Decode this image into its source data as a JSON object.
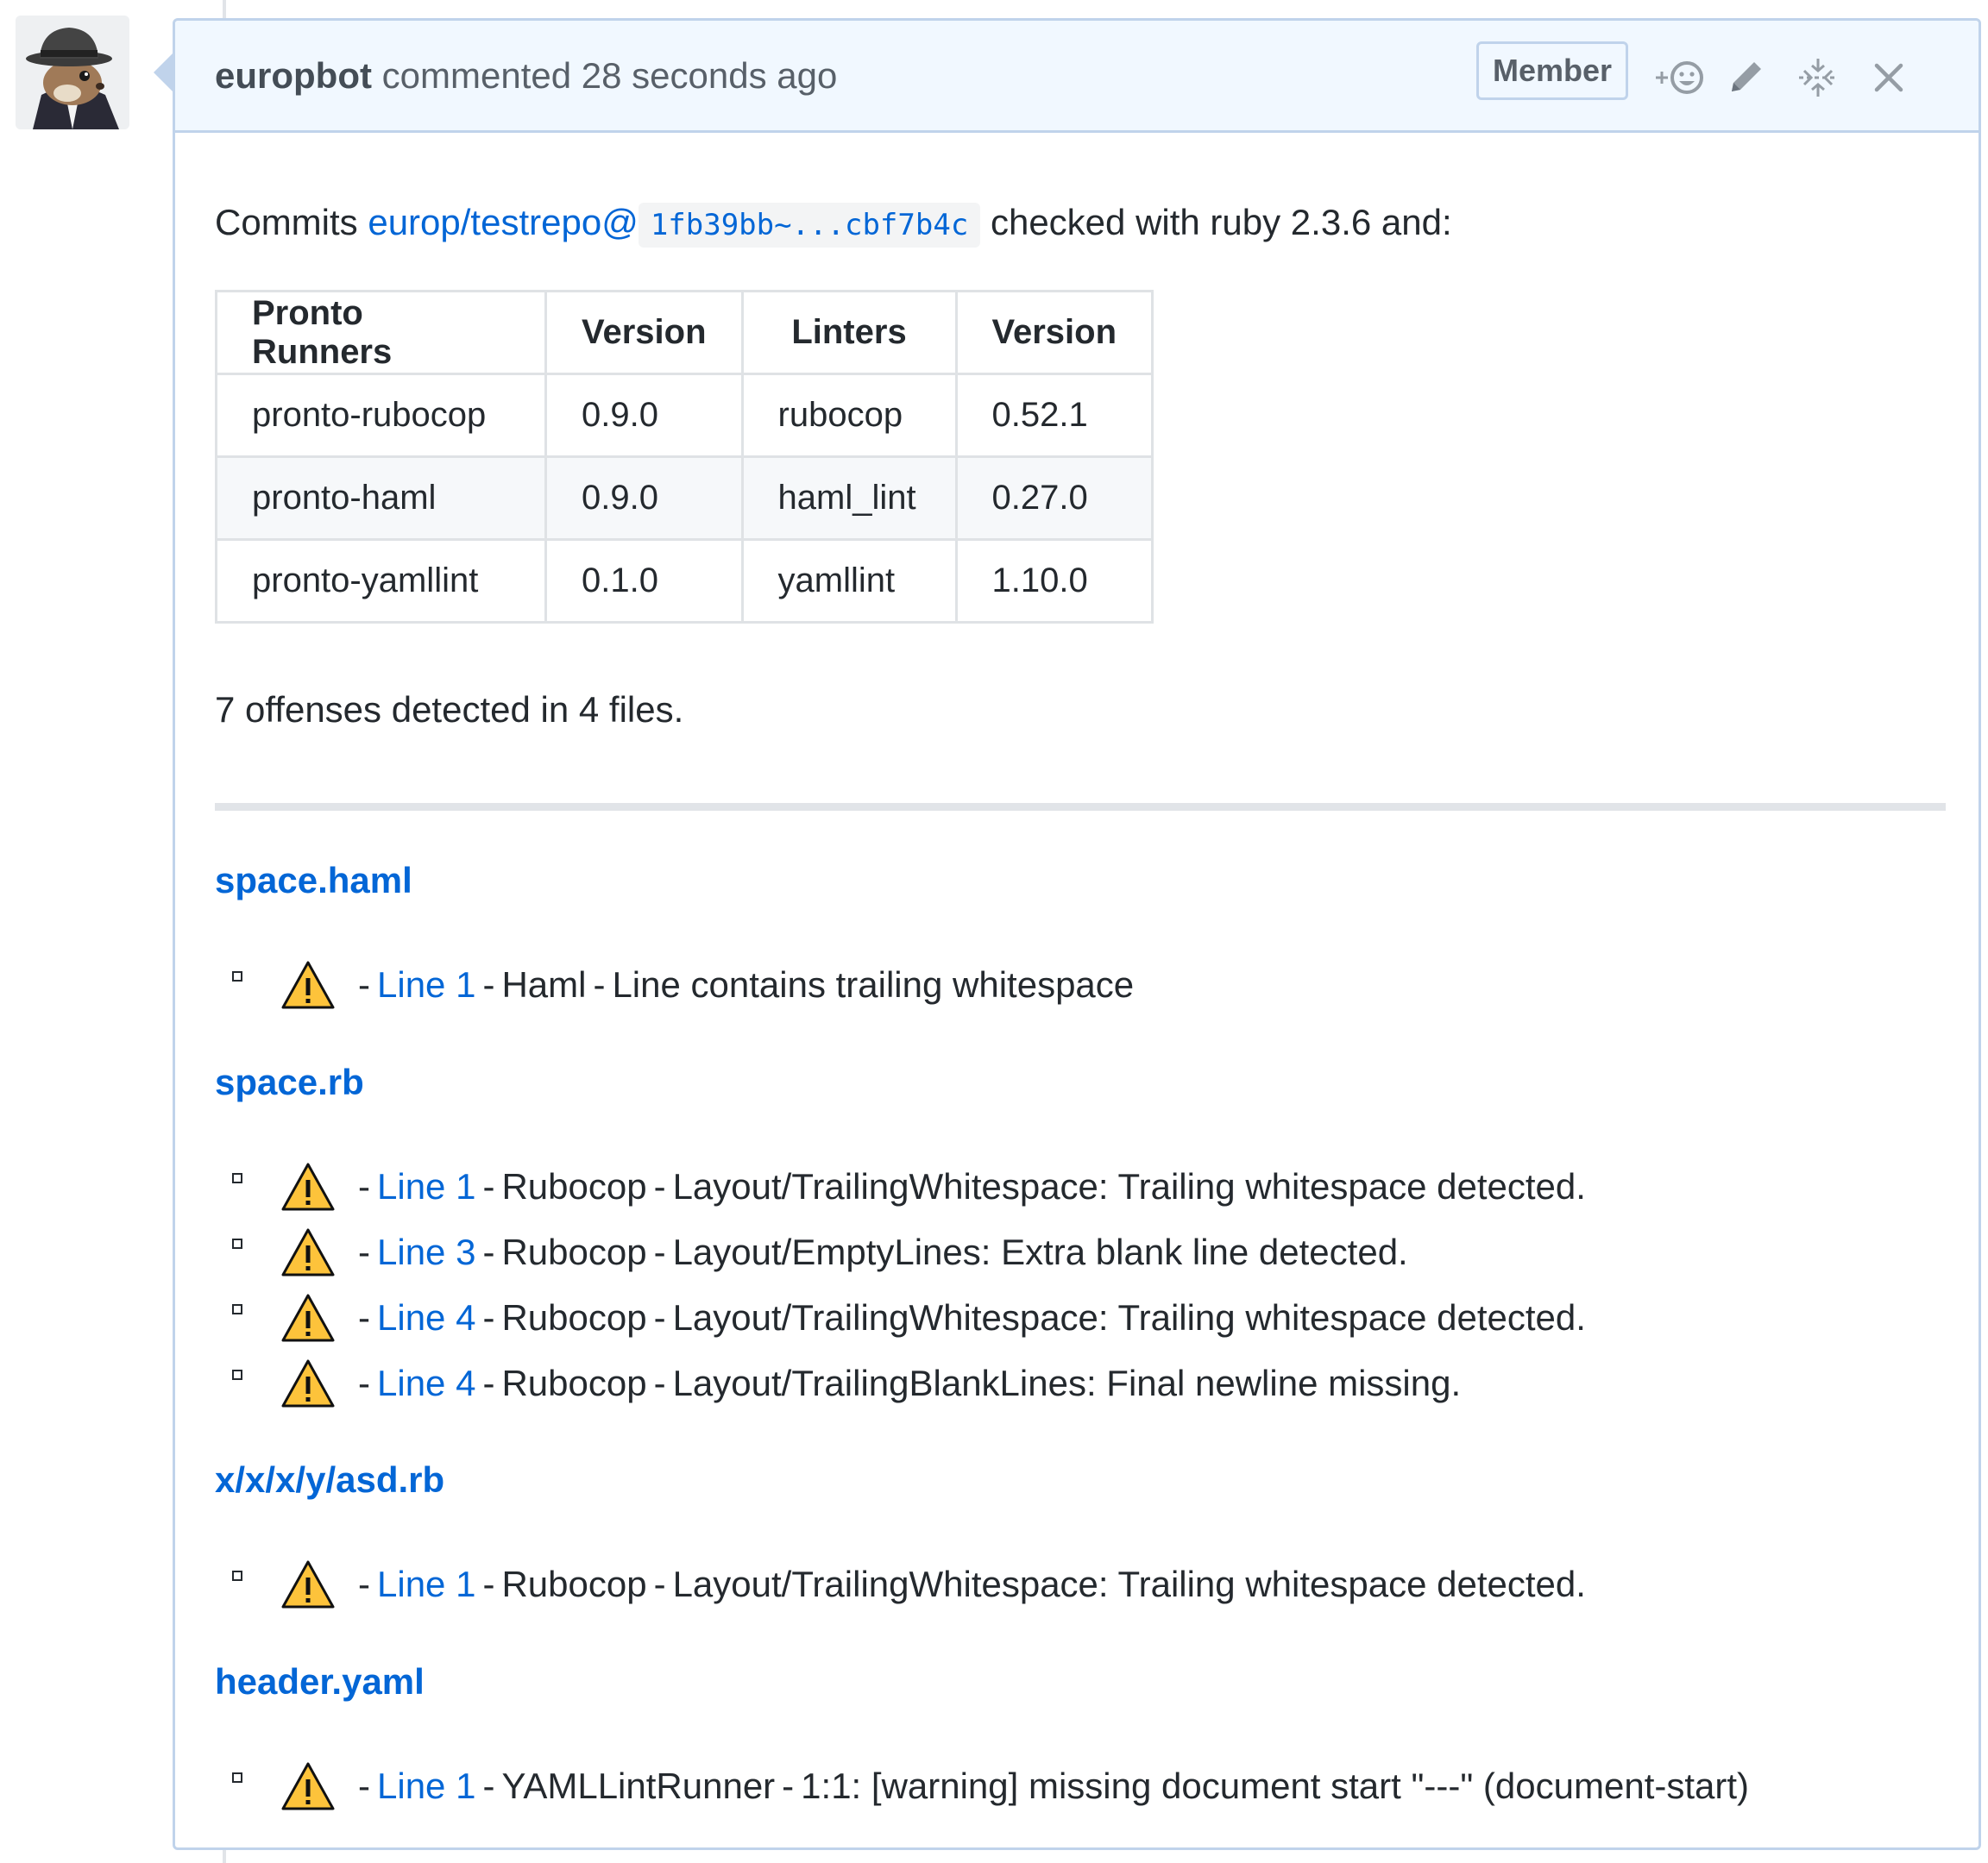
{
  "header": {
    "author": "europbot",
    "action": "commented",
    "time": "28 seconds ago",
    "badge": "Member"
  },
  "icons": {
    "reaction": "add-reaction-icon",
    "edit": "pencil-icon",
    "hide": "unfold-collapse-icon",
    "close": "close-icon",
    "warning": "warning-icon"
  },
  "body": {
    "intro_prefix": "Commits",
    "repo_link": "europ/testrepo@",
    "sha_range": "1fb39bb~...cbf7b4c",
    "intro_suffix": "checked with ruby 2.3.6 and:",
    "table": {
      "headers": [
        "Pronto Runners",
        "Version",
        "Linters",
        "Version"
      ],
      "rows": [
        [
          "pronto-rubocop",
          "0.9.0",
          "rubocop",
          "0.52.1"
        ],
        [
          "pronto-haml",
          "0.9.0",
          "haml_lint",
          "0.27.0"
        ],
        [
          "pronto-yamllint",
          "0.1.0",
          "yamllint",
          "1.10.0"
        ]
      ]
    },
    "summary": "7 offenses detected in 4 files.",
    "files": [
      {
        "name": "space.haml",
        "offenses": [
          {
            "line": "Line 1",
            "runner": "Haml",
            "message": "Line contains trailing whitespace"
          }
        ]
      },
      {
        "name": "space.rb",
        "offenses": [
          {
            "line": "Line 1",
            "runner": "Rubocop",
            "message": "Layout/TrailingWhitespace: Trailing whitespace detected."
          },
          {
            "line": "Line 3",
            "runner": "Rubocop",
            "message": "Layout/EmptyLines: Extra blank line detected."
          },
          {
            "line": "Line 4",
            "runner": "Rubocop",
            "message": "Layout/TrailingWhitespace: Trailing whitespace detected."
          },
          {
            "line": "Line 4",
            "runner": "Rubocop",
            "message": "Layout/TrailingBlankLines: Final newline missing."
          }
        ]
      },
      {
        "name": "x/x/x/y/asd.rb",
        "offenses": [
          {
            "line": "Line 1",
            "runner": "Rubocop",
            "message": "Layout/TrailingWhitespace: Trailing whitespace detected."
          }
        ]
      },
      {
        "name": "header.yaml",
        "offenses": [
          {
            "line": "Line 1",
            "runner": "YAMLLintRunner",
            "message": "1:1: [warning] missing document start \"---\" (document-start)"
          }
        ]
      }
    ],
    "dash": "-"
  },
  "colors": {
    "link": "#0366d6",
    "header_bg": "#f1f8ff",
    "border": "#c0d3eb",
    "warning_fill": "#fdc33b"
  }
}
